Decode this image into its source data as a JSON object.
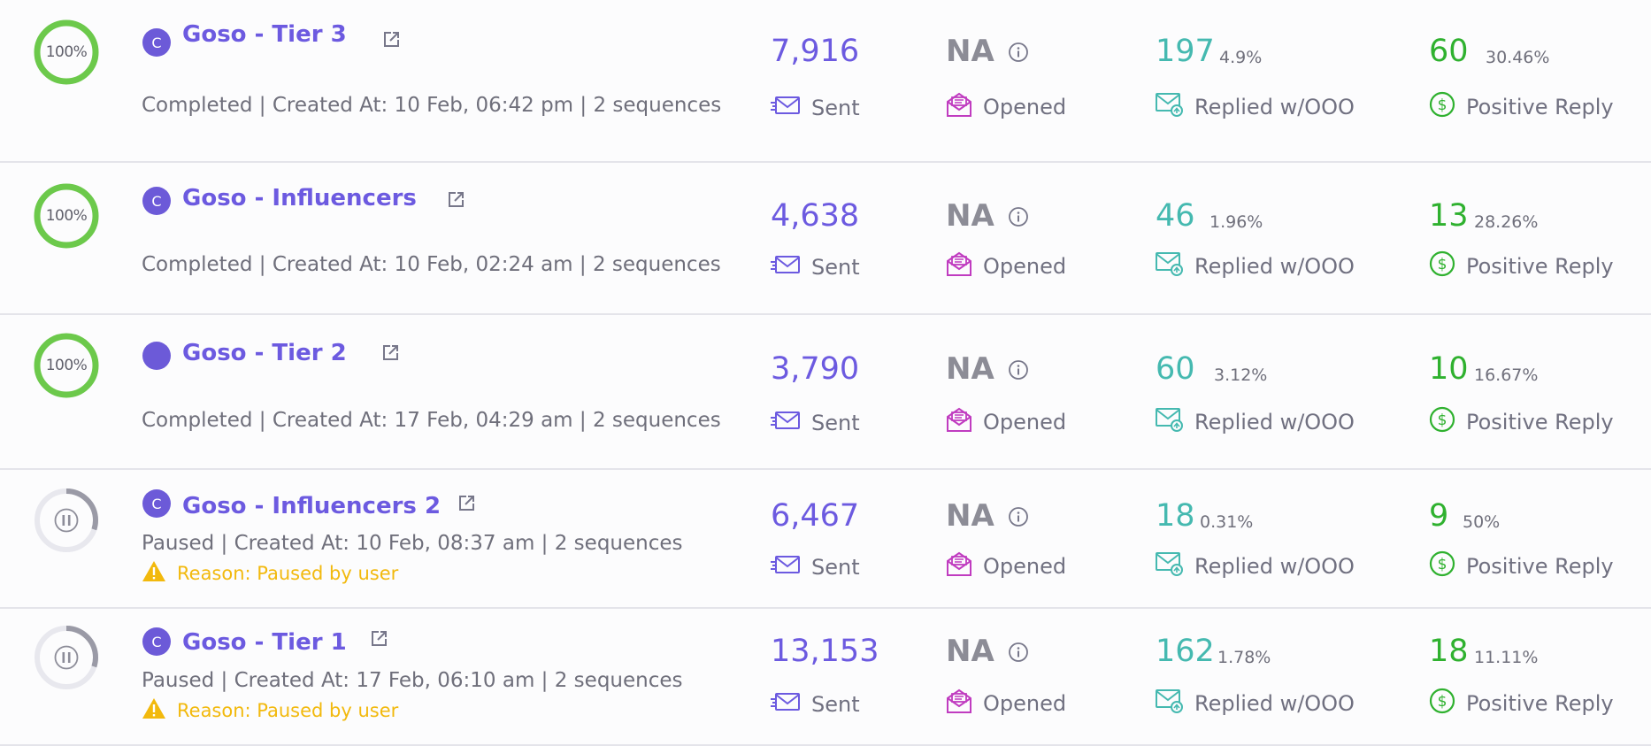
{
  "labels": {
    "sent": "Sent",
    "opened": "Opened",
    "replied": "Replied w/OOO",
    "positive": "Positive Reply"
  },
  "colors": {
    "accent": "#6c5ae0",
    "complete_ring": "#6cc94b",
    "paused_ring": "#9a9aa6",
    "teal": "#45b9b0",
    "green": "#2fb12f",
    "opened_icon": "#c03cc0",
    "warning": "#f2b90d"
  },
  "campaigns": [
    {
      "status": "completed",
      "progress_label": "100%",
      "progress": 1.0,
      "avatar_letter": "C",
      "name": "Goso - Tier 3",
      "meta": "Completed | Created At: 10 Feb, 06:42 pm | 2 sequences",
      "sent": "7,916",
      "opened": "NA",
      "replied": "197",
      "replied_pct": "4.9%",
      "positive": "60",
      "positive_pct": "30.46%"
    },
    {
      "status": "completed",
      "progress_label": "100%",
      "progress": 1.0,
      "avatar_letter": "C",
      "name": "Goso - Influencers",
      "meta": "Completed | Created At: 10 Feb, 02:24 am | 2 sequences",
      "sent": "4,638",
      "opened": "NA",
      "replied": "46",
      "replied_pct": "1.96%",
      "positive": "13",
      "positive_pct": "28.26%"
    },
    {
      "status": "completed",
      "progress_label": "100%",
      "progress": 1.0,
      "avatar_letter": "",
      "name": "Goso - Tier 2",
      "meta": "Completed | Created At: 17 Feb, 04:29 am | 2 sequences",
      "sent": "3,790",
      "opened": "NA",
      "replied": "60",
      "replied_pct": "3.12%",
      "positive": "10",
      "positive_pct": "16.67%"
    },
    {
      "status": "paused",
      "progress_label": "",
      "progress": 0.3,
      "avatar_letter": "C",
      "name": "Goso - Influencers 2",
      "meta": "Paused | Created At: 10 Feb, 08:37 am | 2 sequences",
      "reason": "Reason: Paused by user",
      "sent": "6,467",
      "opened": "NA",
      "replied": "18",
      "replied_pct": "0.31%",
      "positive": "9",
      "positive_pct": "50%"
    },
    {
      "status": "paused",
      "progress_label": "",
      "progress": 0.3,
      "avatar_letter": "C",
      "name": "Goso - Tier 1",
      "meta": "Paused | Created At: 17 Feb, 06:10 am | 2 sequences",
      "reason": "Reason: Paused by user",
      "sent": "13,153",
      "opened": "NA",
      "replied": "162",
      "replied_pct": "1.78%",
      "positive": "18",
      "positive_pct": "11.11%"
    }
  ]
}
